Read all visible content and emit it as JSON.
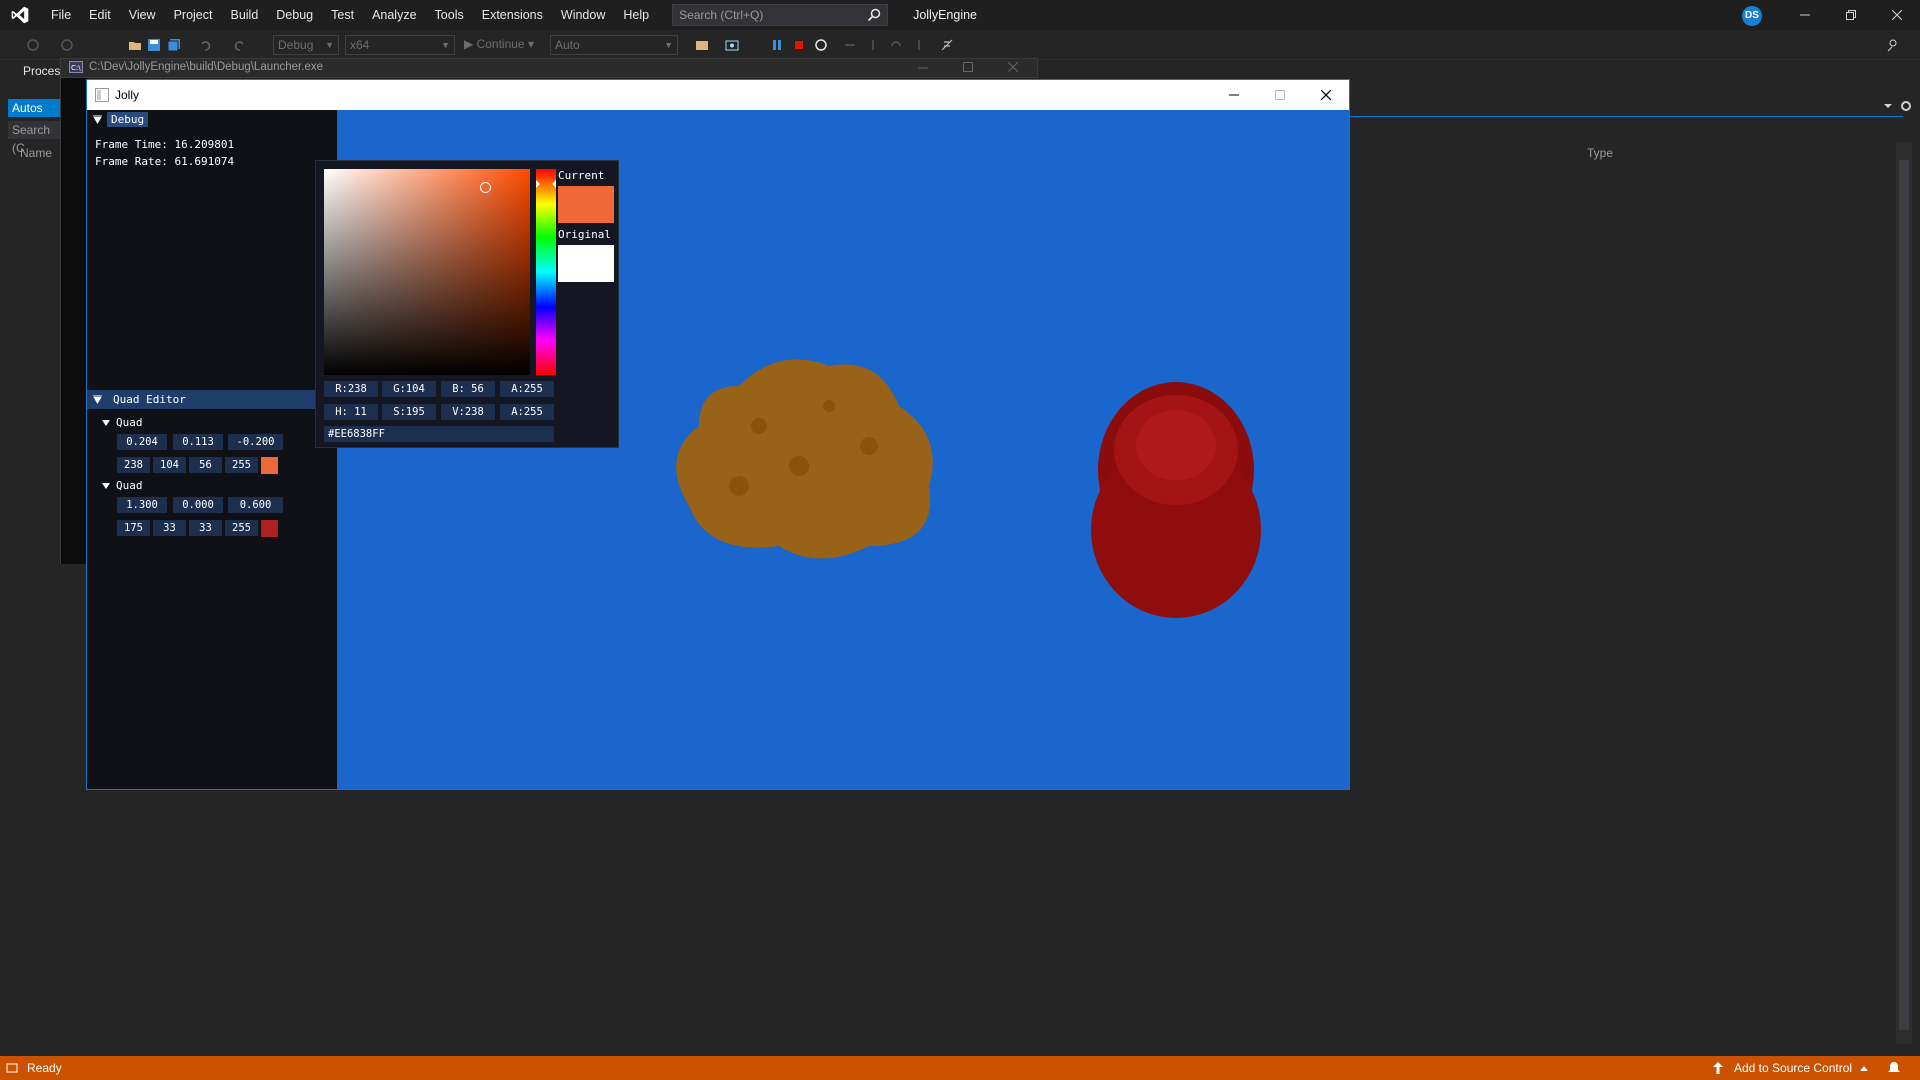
{
  "vs": {
    "menu": [
      "File",
      "Edit",
      "View",
      "Project",
      "Build",
      "Debug",
      "Test",
      "Analyze",
      "Tools",
      "Extensions",
      "Window",
      "Help"
    ],
    "search_placeholder": "Search (Ctrl+Q)",
    "solution_name": "JollyEngine",
    "profile_initials": "DS",
    "toolbar": {
      "config": "Debug",
      "platform": "x64",
      "continue_label": "Continue",
      "auto_label": "Auto"
    },
    "process_label": "Proces",
    "autos_tab": "Autos",
    "autos_search": "Search (C",
    "col_name": "Name",
    "col_type": "Type",
    "status_ready": "Ready",
    "source_control": "Add to Source Control",
    "accent_color": "#007acc",
    "status_color": "#ca5100"
  },
  "console": {
    "title": "C:\\Dev\\JollyEngine\\build\\Debug\\Launcher.exe"
  },
  "jolly": {
    "title": "Jolly",
    "background_color": "#1a66cc",
    "debug": {
      "header": "Debug",
      "frame_time": "Frame Time: 16.209801",
      "frame_rate": "Frame Rate: 61.691074"
    },
    "quad_editor": {
      "header": "Quad Editor",
      "quads": [
        {
          "label": "Quad",
          "position": [
            "0.204",
            "0.113",
            "-0.200"
          ],
          "color": [
            "238",
            "104",
            "56",
            "255"
          ],
          "swatch": "#ee6838"
        },
        {
          "label": "Quad",
          "position": [
            "1.300",
            "0.000",
            "0.600"
          ],
          "color": [
            "175",
            "33",
            "33",
            "255"
          ],
          "swatch": "#af2121"
        }
      ]
    },
    "color_picker": {
      "current_label": "Current",
      "original_label": "Original",
      "current_color": "#ee6838",
      "original_color": "#ffffff",
      "rgb": [
        "R:238",
        "G:104",
        "B: 56",
        "A:255"
      ],
      "hsv": [
        "H: 11",
        "S:195",
        "V:238",
        "A:255"
      ],
      "hex": "#EE6838FF"
    }
  }
}
